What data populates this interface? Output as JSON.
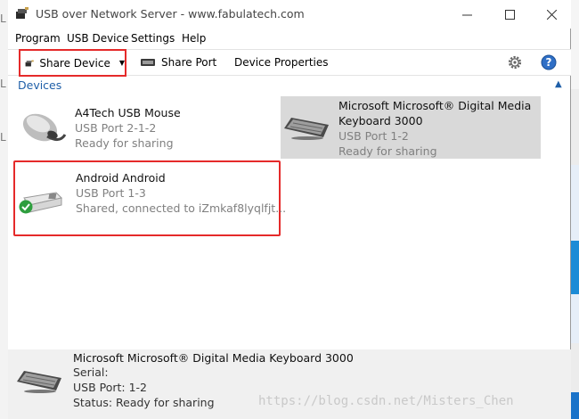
{
  "window": {
    "title": "USB over Network Server - www.fabulatech.com",
    "minimize_glyph": "—",
    "maximize_glyph": "☐",
    "close_glyph": "✕"
  },
  "menu": [
    "Program",
    "USB Device",
    "Settings",
    "Help"
  ],
  "toolbar": {
    "share_device": "Share Device",
    "share_port": "Share Port",
    "device_properties": "Device Properties",
    "settings_icon": "gear-icon",
    "help_icon": "help-icon"
  },
  "group": {
    "label": "Devices",
    "collapse_glyph": "▲"
  },
  "devices": [
    {
      "name": "A4Tech USB Mouse",
      "port": "USB Port   2-1-2",
      "status": "Ready for sharing",
      "icon": "mouse-icon"
    },
    {
      "name": "Microsoft Microsoft® Digital Media Keyboard 3000",
      "port": "USB Port   1-2",
      "status": "Ready for sharing",
      "icon": "keyboard-icon",
      "selected": true
    },
    {
      "name": "Android Android",
      "port": "USB Port   1-3",
      "status": "Shared, connected to iZmkaf8lyqlfjt...",
      "icon": "usb-drive-icon"
    }
  ],
  "details": {
    "title": "Microsoft Microsoft® Digital Media Keyboard 3000",
    "serial": "Serial:",
    "port": "USB Port: 1-2",
    "status": "Status: Ready for sharing"
  },
  "background_letters": [
    "L",
    "L",
    "L"
  ],
  "watermark": "https://blog.csdn.net/Misters_Chen",
  "colors": {
    "highlight_border": "#e52a2a",
    "group_header": "#1f5fa8",
    "selected_tile": "#d9d9d9"
  }
}
